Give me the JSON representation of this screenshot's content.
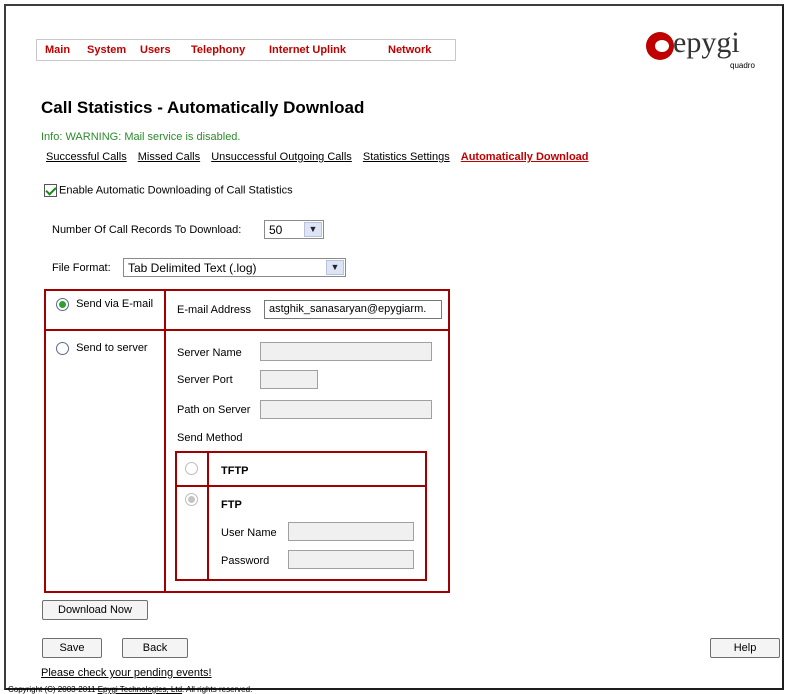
{
  "menu": {
    "items": [
      "Main",
      "System",
      "Users",
      "Telephony",
      "Internet Uplink",
      "Network"
    ]
  },
  "logo": {
    "word": "epygi",
    "sub": "quadro"
  },
  "page": {
    "title": "Call Statistics - Automatically Download",
    "info": "Info: WARNING: Mail service is disabled."
  },
  "tabs": [
    "Successful Calls",
    "Missed Calls",
    "Unsuccessful Outgoing Calls",
    "Statistics Settings",
    "Automatically Download"
  ],
  "form": {
    "enable_label": "Enable Automatic Downloading of Call Statistics",
    "records_label": "Number Of Call Records To Download:",
    "records_value": "50",
    "format_label": "File Format:",
    "format_value": "Tab Delimited Text (.log)",
    "send_email_label": "Send via E-mail",
    "email_address_label": "E-mail Address",
    "email_value": "astghik_sanasaryan@epygiarm.",
    "send_server_label": "Send to server",
    "server_name_label": "Server Name",
    "server_port_label": "Server Port",
    "path_label": "Path on Server",
    "send_method_label": "Send Method",
    "tftp_label": "TFTP",
    "ftp_label": "FTP",
    "user_name_label": "User Name",
    "password_label": "Password"
  },
  "buttons": {
    "download_now": "Download Now",
    "save": "Save",
    "back": "Back",
    "help": "Help"
  },
  "footer": {
    "pending": "Please check your pending events!",
    "copyright_prefix": "Copyright (C) 2003-2011 ",
    "company": "Epygi Technologies, Ltd",
    "copyright_suffix": ". All rights reserved."
  },
  "colors": {
    "accent": "#c00000",
    "info": "#2c8a2c",
    "border": "#a00000"
  }
}
